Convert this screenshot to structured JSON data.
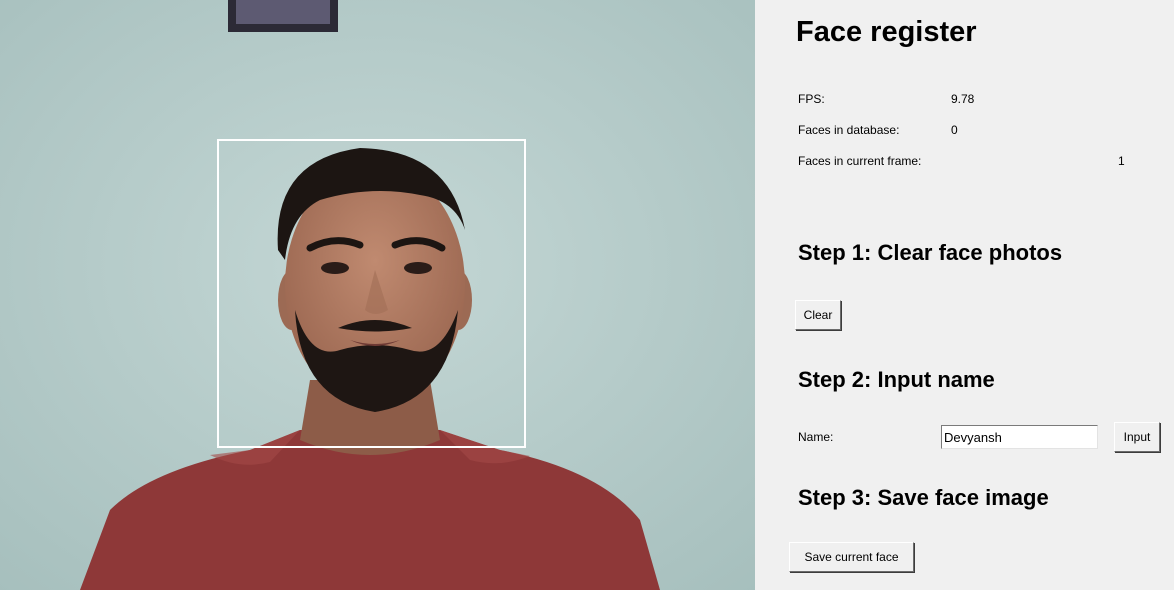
{
  "window": {
    "title": "Face register"
  },
  "stats": {
    "fps_label": "FPS:",
    "fps_value": "9.78",
    "db_label": "Faces in database:",
    "db_value": "0",
    "frame_label": "Faces in current frame:",
    "frame_value": "1"
  },
  "step1": {
    "title": "Step 1: Clear face photos",
    "clear_button": "Clear"
  },
  "step2": {
    "title": "Step 2: Input name",
    "name_label": "Name:",
    "name_value": "Devyansh",
    "input_button": "Input"
  },
  "step3": {
    "title": "Step 3: Save face image",
    "save_button": "Save current face"
  },
  "camera": {
    "wall_color": "#b3cccb",
    "shirt_color": "#8e3838",
    "face_box_color": "#ffffff"
  }
}
